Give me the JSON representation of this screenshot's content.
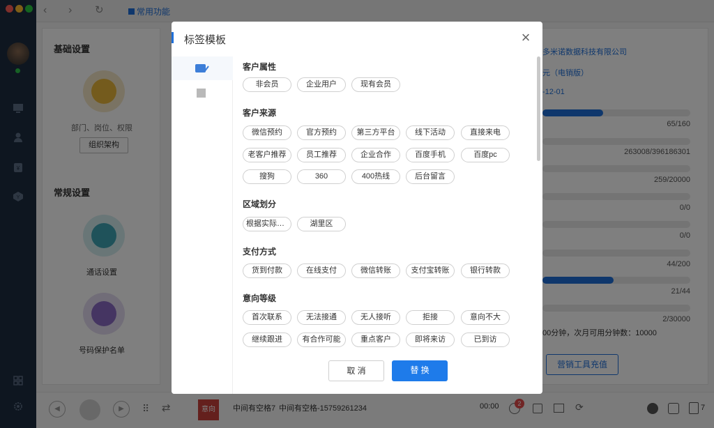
{
  "topbar": {
    "tab_label": "常用功能"
  },
  "settings": {
    "basic_title": "基础设置",
    "org_desc": "部门、岗位、权限",
    "org_button": "组织架构",
    "general_title": "常规设置",
    "call_settings": "通话设置",
    "protect_list": "号码保护名单"
  },
  "account": {
    "company": "多米诺数据科技有限公司",
    "edition": "元（电销版）",
    "date": "-12-01",
    "usage": [
      {
        "label": "65/160",
        "fraction": 0.41
      },
      {
        "label": "263008/396186301",
        "fraction": 0.0
      },
      {
        "label": "259/20000",
        "fraction": 0.0
      },
      {
        "label": "0/0",
        "fraction": 0.0
      },
      {
        "label": "0/0",
        "fraction": 0.0
      },
      {
        "label": "44/200",
        "fraction": 0.0
      },
      {
        "label": "21/44",
        "fraction": 0.48
      },
      {
        "label": "2/30000",
        "fraction": 0.0
      }
    ],
    "minutes_note": "00分钟，次月可用分钟数：10000",
    "recharge_button": "营销工具充值"
  },
  "modal": {
    "title": "标签模板",
    "groups": [
      {
        "title": "客户属性",
        "tags": [
          "非会员",
          "企业用户",
          "现有会员"
        ]
      },
      {
        "title": "客户来源",
        "tags": [
          "微信预约",
          "官方预约",
          "第三方平台",
          "线下活动",
          "直接来电",
          "老客户推荐",
          "员工推荐",
          "企业合作",
          "百度手机",
          "百度pc",
          "搜狗",
          "360",
          "400热线",
          "后台留言"
        ]
      },
      {
        "title": "区域划分",
        "tags": [
          "根据实际情况...",
          "湖里区"
        ]
      },
      {
        "title": "支付方式",
        "tags": [
          "货到付款",
          "在线支付",
          "微信转账",
          "支付宝转账",
          "银行转款"
        ]
      },
      {
        "title": "意向等级",
        "tags": [
          "首次联系",
          "无法接通",
          "无人接听",
          "拒接",
          "意向不大",
          "继续跟进",
          "有合作可能",
          "重点客户",
          "即将来访",
          "已到访"
        ]
      }
    ],
    "cancel": "取 消",
    "replace": "替 换"
  },
  "callbar": {
    "intent_badge": "意向",
    "caller_name": "中间有空格7",
    "caller_detail": "中间有空格-15759261234",
    "duration": "00:00",
    "notification_count": "2",
    "extra_count": "7"
  },
  "colors": {
    "accent": "#1e6fd9",
    "sidebar": "#1c2c40",
    "badge_red": "#e04b4b"
  }
}
